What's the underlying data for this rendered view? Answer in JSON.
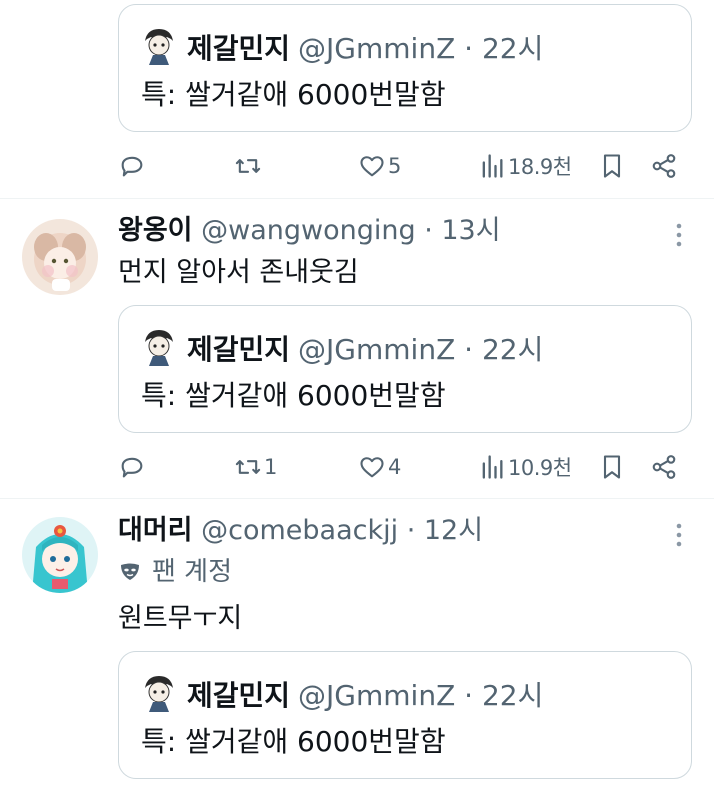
{
  "quoted_tweet": {
    "display_name": "제갈민지",
    "meta": "@JGmminZ · 22시",
    "text": "특: 쌀거같애 6000번말함"
  },
  "posts": [
    {
      "actions": {
        "replies": "",
        "retweets": "",
        "likes": "5",
        "views": "18.9천"
      }
    },
    {
      "display_name": "왕옹이",
      "meta": "@wangwonging · 13시",
      "text": "먼지 알아서 존내웃김",
      "actions": {
        "replies": "",
        "retweets": "1",
        "likes": "4",
        "views": "10.9천"
      }
    },
    {
      "display_name": "대머리",
      "meta": "@comebaackjj · 12시",
      "fan_account_label": "팬 계정",
      "text": "원트무ㅜ지"
    }
  ],
  "icons": {
    "reply": "reply-icon",
    "retweet": "retweet-icon",
    "like": "heart-icon",
    "views": "views-icon",
    "bookmark": "bookmark-icon",
    "share": "share-icon",
    "more": "more-icon",
    "mask": "mask-icon"
  },
  "colors": {
    "text_primary": "#0f1419",
    "text_secondary": "#536471",
    "border": "#cfd9de",
    "divider": "#eff3f4"
  }
}
